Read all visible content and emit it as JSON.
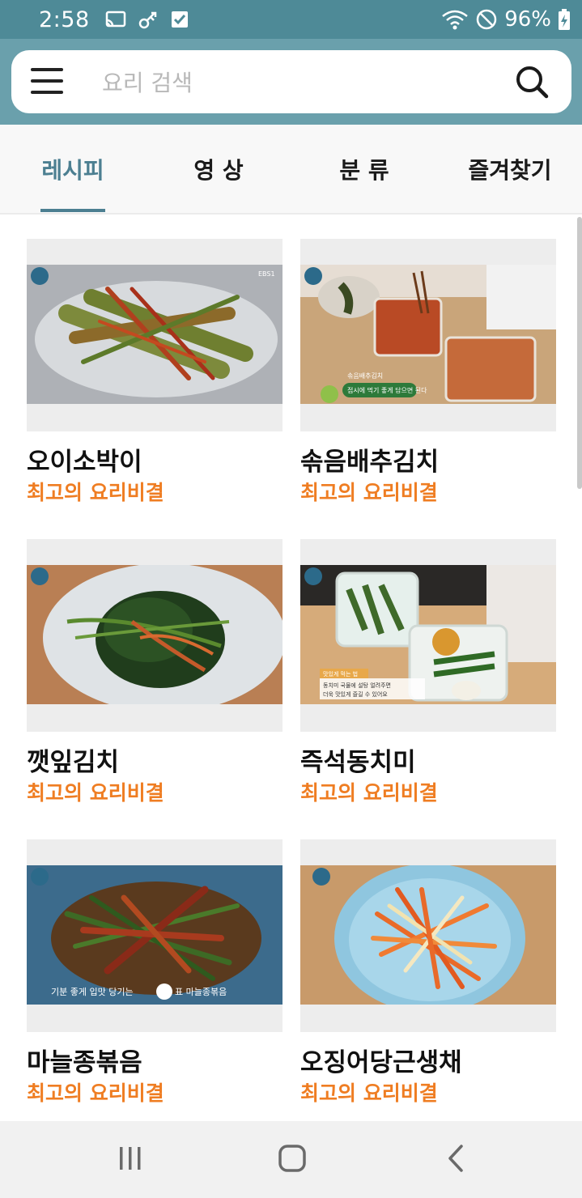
{
  "status_bar": {
    "time": "2:58",
    "battery": "96%",
    "icons": [
      "cast-icon",
      "link-icon",
      "checkbox-icon",
      "wifi-icon",
      "dnd-icon",
      "battery-charging-icon"
    ]
  },
  "search": {
    "placeholder": "요리 검색",
    "value": ""
  },
  "tabs": [
    {
      "label": "레시피",
      "active": true
    },
    {
      "label": "영 상",
      "active": false
    },
    {
      "label": "분 류",
      "active": false
    },
    {
      "label": "즐겨찾기",
      "active": false
    }
  ],
  "recipes": [
    {
      "title": "오이소박이",
      "subtitle": "최고의 요리비결"
    },
    {
      "title": "솎음배추김치",
      "subtitle": "최고의 요리비결"
    },
    {
      "title": "깻잎김치",
      "subtitle": "최고의 요리비결"
    },
    {
      "title": "즉석동치미",
      "subtitle": "최고의 요리비결"
    },
    {
      "title": "마늘종볶음",
      "subtitle": "최고의 요리비결"
    },
    {
      "title": "오징어당근생채",
      "subtitle": "최고의 요리비결"
    }
  ],
  "thumbnail_text": {
    "broadcaster": "EBS1",
    "kimchi_caption_top": "솎음배추김치",
    "kimchi_caption": "접시에 먹기 좋게 담으면 된다",
    "dongchimi_tip_title": "맛있게 먹는 법",
    "dongchimi_tip_line1": "동치미 국물에 설탕 얼려주면",
    "dongchimi_tip_line2": "더욱 맛있게 즐길 수 있어요",
    "garlic_caption_a": "기분 좋게 입맛 당기는",
    "garlic_caption_b": "표 마늘종볶음"
  },
  "colors": {
    "status_bar": "#4e8a97",
    "header": "#6aa0ac",
    "tab_active": "#4c7f91",
    "subtitle": "#ef7d22"
  }
}
